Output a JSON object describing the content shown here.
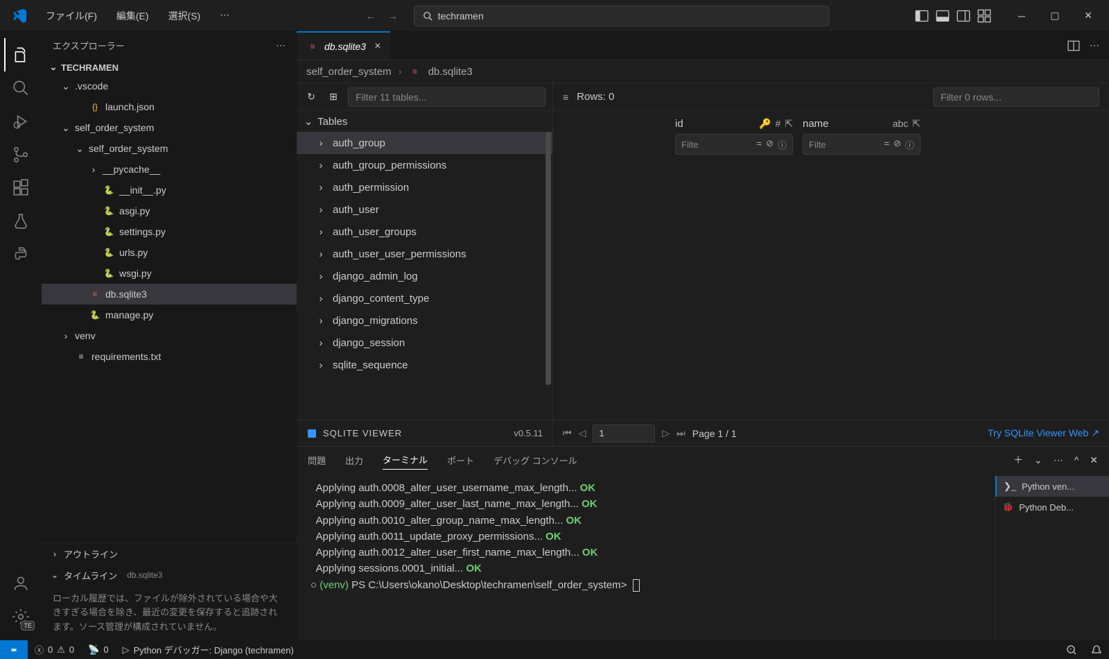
{
  "menu": {
    "file": "ファイル(F)",
    "edit": "編集(E)",
    "select": "選択(S)"
  },
  "search_text": "techramen",
  "sidebar": {
    "title": "エクスプローラー",
    "root": "TECHRAMEN",
    "outline": "アウトライン",
    "timeline": "タイムライン",
    "timeline_file": "db.sqlite3",
    "timeline_note": "ローカル履歴では、ファイルが除外されている場合や大きすぎる場合を除き、最近の変更を保存すると追跡されます。ソース管理が構成されていません。"
  },
  "tree": {
    "vscode": ".vscode",
    "launch": "launch.json",
    "sos": "self_order_system",
    "sos2": "self_order_system",
    "pycache": "__pycache__",
    "init": "__init__.py",
    "asgi": "asgi.py",
    "settings": "settings.py",
    "urls": "urls.py",
    "wsgi": "wsgi.py",
    "db": "db.sqlite3",
    "manage": "manage.py",
    "venv": "venv",
    "req": "requirements.txt"
  },
  "tab": {
    "name": "db.sqlite3"
  },
  "breadcrumb": {
    "p0": "self_order_system",
    "p1": "db.sqlite3"
  },
  "sqlite": {
    "filter_tables": "Filter 11 tables...",
    "tables_label": "Tables",
    "tables": {
      "t0": "auth_group",
      "t1": "auth_group_permissions",
      "t2": "auth_permission",
      "t3": "auth_user",
      "t4": "auth_user_groups",
      "t5": "auth_user_user_permissions",
      "t6": "django_admin_log",
      "t7": "django_content_type",
      "t8": "django_migrations",
      "t9": "django_session",
      "t10": "sqlite_sequence"
    },
    "rows_label": "Rows: 0",
    "filter_rows": "Filter 0 rows...",
    "col_id": "id",
    "col_name": "name",
    "col_filter": "Filte",
    "brand": "SQLITE VIEWER",
    "version": "v0.5.11",
    "page_input": "1",
    "page_text": "Page 1 / 1",
    "link": "Try SQLite Viewer Web ↗"
  },
  "panel": {
    "t_problems": "問題",
    "t_output": "出力",
    "t_terminal": "ターミナル",
    "t_ports": "ポート",
    "t_debug": "デバッグ コンソール",
    "side_venv": "Python ven...",
    "side_debug": "Python Deb..."
  },
  "terminal": {
    "l0a": "  Applying auth.0008_alter_user_username_max_length... ",
    "l0b": "OK",
    "l1a": "  Applying auth.0009_alter_user_last_name_max_length... ",
    "l1b": "OK",
    "l2a": "  Applying auth.0010_alter_group_name_max_length... ",
    "l2b": "OK",
    "l3a": "  Applying auth.0011_update_proxy_permissions... ",
    "l3b": "OK",
    "l4a": "  Applying auth.0012_alter_user_first_name_max_length... ",
    "l4b": "OK",
    "l5a": "  Applying sessions.0001_initial... ",
    "l5b": "OK",
    "prompt_circle": "○ ",
    "prompt_venv": "(venv) ",
    "prompt_path": "PS C:\\Users\\okano\\Desktop\\techramen\\self_order_system> "
  },
  "status": {
    "errors": "0",
    "warnings": "0",
    "ports": "0",
    "debugger": "Python デバッガー: Django (techramen)"
  }
}
